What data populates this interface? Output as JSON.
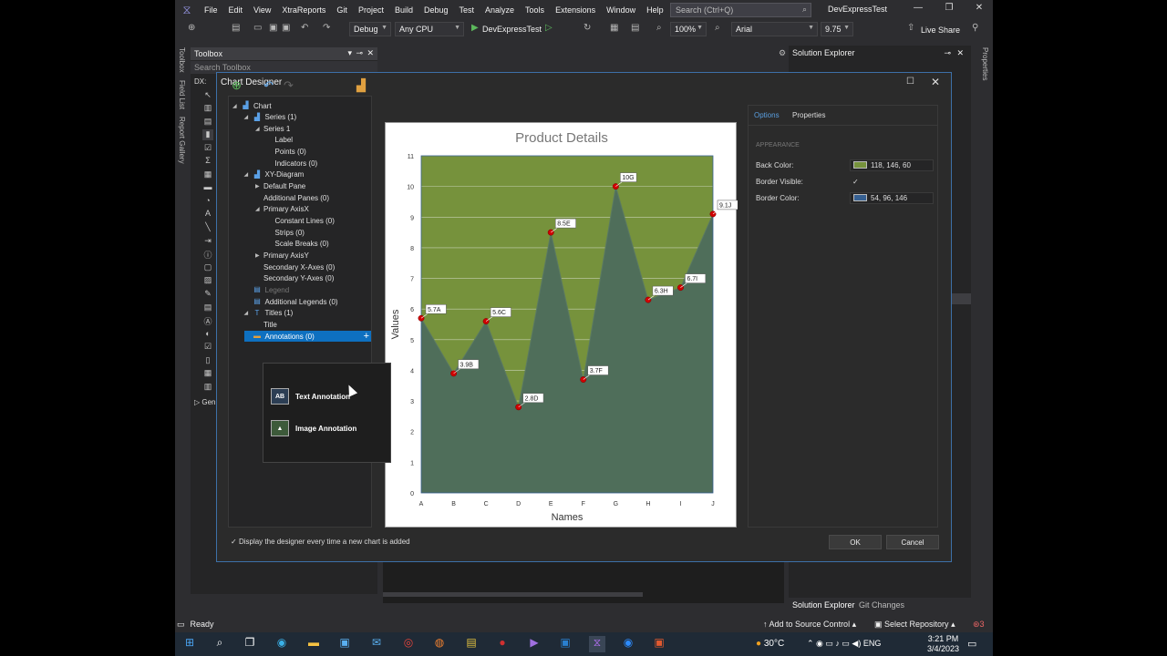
{
  "vs": {
    "menu": [
      "File",
      "Edit",
      "View",
      "XtraReports",
      "Git",
      "Project",
      "Build",
      "Debug",
      "Test",
      "Analyze",
      "Tools",
      "Extensions",
      "Window",
      "Help"
    ],
    "search_placeholder": "Search (Ctrl+Q)",
    "title": "DevExpressTest",
    "config": "Debug",
    "platform": "Any CPU",
    "run_target": "DevExpressTest",
    "zoom": "100%",
    "font": "Arial",
    "font_size": "9.75",
    "live_share": "Live Share",
    "side_tabs": [
      "Toolbox",
      "Field List",
      "Report Gallery"
    ],
    "right_tab": "Properties",
    "toolbox_title": "Toolbox",
    "toolbox_search": "Search Toolbox",
    "toolbox_group": "DX:",
    "toolbox_general": "Gen",
    "solution_explorer_title": "Solution Explorer",
    "bottom_tabs": [
      "Solution Explorer",
      "Git Changes"
    ],
    "status": {
      "ready": "Ready",
      "source_control": "Add to Source Control",
      "repository": "Select Repository",
      "notif_count": "3"
    }
  },
  "dialog": {
    "title": "Chart Designer",
    "tree": [
      {
        "label": "Chart",
        "level": 0,
        "arrow": "open",
        "icon": "chart-icon"
      },
      {
        "label": "Series (1)",
        "level": 1,
        "arrow": "open",
        "icon": "series-icon"
      },
      {
        "label": "Series 1",
        "level": 2,
        "arrow": "open",
        "icon": ""
      },
      {
        "label": "Label",
        "level": 3,
        "arrow": "",
        "icon": ""
      },
      {
        "label": "Points (0)",
        "level": 3,
        "arrow": "",
        "icon": ""
      },
      {
        "label": "Indicators (0)",
        "level": 3,
        "arrow": "",
        "icon": ""
      },
      {
        "label": "XY-Diagram",
        "level": 1,
        "arrow": "open",
        "icon": "diagram-icon"
      },
      {
        "label": "Default Pane",
        "level": 2,
        "arrow": "closed",
        "icon": ""
      },
      {
        "label": "Additional Panes (0)",
        "level": 2,
        "arrow": "",
        "icon": ""
      },
      {
        "label": "Primary AxisX",
        "level": 2,
        "arrow": "open",
        "icon": ""
      },
      {
        "label": "Constant Lines (0)",
        "level": 3,
        "arrow": "",
        "icon": ""
      },
      {
        "label": "Strips (0)",
        "level": 3,
        "arrow": "",
        "icon": ""
      },
      {
        "label": "Scale Breaks (0)",
        "level": 3,
        "arrow": "",
        "icon": ""
      },
      {
        "label": "Primary AxisY",
        "level": 2,
        "arrow": "closed",
        "icon": ""
      },
      {
        "label": "Secondary X-Axes (0)",
        "level": 2,
        "arrow": "",
        "icon": ""
      },
      {
        "label": "Secondary Y-Axes (0)",
        "level": 2,
        "arrow": "",
        "icon": ""
      },
      {
        "label": "Legend",
        "level": 1,
        "arrow": "",
        "icon": "legend-icon",
        "dim": true
      },
      {
        "label": "Additional Legends (0)",
        "level": 1,
        "arrow": "",
        "icon": "legend-icon"
      },
      {
        "label": "Titles (1)",
        "level": 1,
        "arrow": "open",
        "icon": "title-icon"
      },
      {
        "label": "Title",
        "level": 2,
        "arrow": "",
        "icon": ""
      },
      {
        "label": "Annotations (0)",
        "level": 1,
        "arrow": "",
        "icon": "annotation-icon",
        "selected": true
      }
    ],
    "annotation_menu": [
      "Text Annotation",
      "Image Annotation"
    ],
    "tabs": [
      "Options",
      "Properties"
    ],
    "section": "APPEARANCE",
    "props": [
      {
        "label": "Back Color:",
        "value": "118, 146, 60",
        "swatch": "#76923c"
      },
      {
        "label": "Border Visible:",
        "value": "✓",
        "swatch": ""
      },
      {
        "label": "Border Color:",
        "value": "54, 96, 146",
        "swatch": "#366092"
      }
    ],
    "checkbox_label": "Display the designer every time a new chart is added",
    "ok": "OK",
    "cancel": "Cancel"
  },
  "chart_data": {
    "type": "area",
    "title": "Product Details",
    "xlabel": "Names",
    "ylabel": "Values",
    "categories": [
      "A",
      "B",
      "C",
      "D",
      "E",
      "F",
      "G",
      "H",
      "I",
      "J"
    ],
    "values": [
      5.7,
      3.9,
      5.6,
      2.8,
      8.5,
      3.7,
      10,
      6.3,
      6.7,
      9.1
    ],
    "point_labels": [
      "5.7A",
      "3.9B",
      "5.6C",
      "2.8D",
      "8.5E",
      "3.7F",
      "10G",
      "6.3H",
      "6.7I",
      "9.1J"
    ],
    "ylim": [
      0,
      11
    ],
    "yticks": [
      0,
      1,
      2,
      3,
      4,
      5,
      6,
      7,
      8,
      9,
      10,
      11
    ],
    "grid": true,
    "colors": {
      "background": "#76923c",
      "area": "#4f6e5a",
      "marker": "#d00000",
      "border": "#366092"
    }
  },
  "taskbar": {
    "weather": "30°C",
    "lang": "ENG",
    "time": "3:21 PM",
    "date": "3/4/2023"
  }
}
